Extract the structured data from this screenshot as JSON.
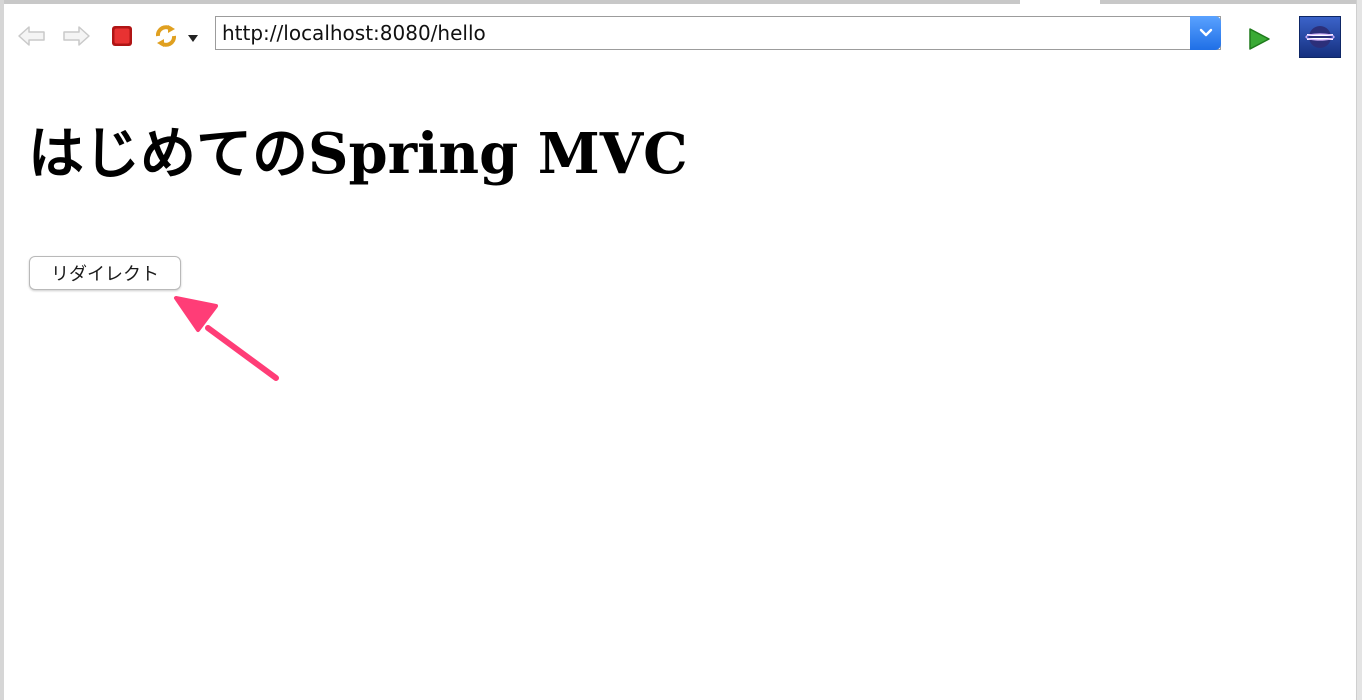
{
  "browser": {
    "url": "http://localhost:8080/hello",
    "icons": {
      "back": "back-arrow-icon",
      "forward": "forward-arrow-icon",
      "stop": "stop-icon",
      "refresh": "refresh-icon",
      "go": "go-play-icon",
      "eclipse": "eclipse-logo-icon"
    }
  },
  "page": {
    "title": "はじめてのSpring MVC",
    "redirect_button_label": "リダイレクト"
  },
  "colors": {
    "annotation_arrow": "#ff3d77",
    "stop_red": "#e02828",
    "go_green": "#3aaa35",
    "dropdown_blue": "#2f80ed"
  }
}
